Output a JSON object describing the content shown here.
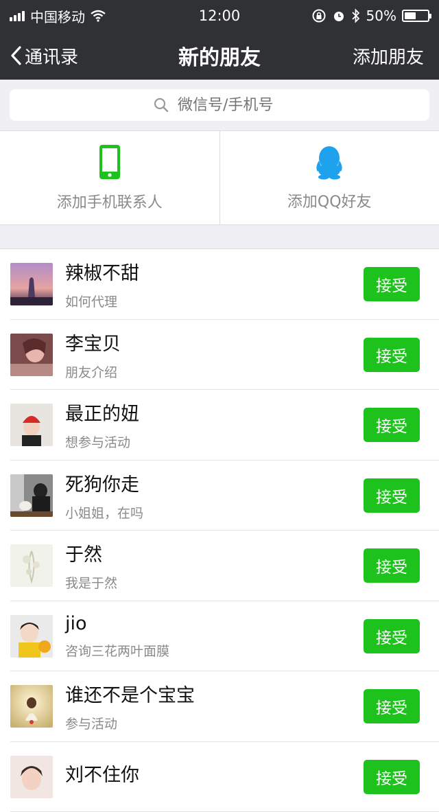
{
  "status_bar": {
    "carrier": "中国移动",
    "time": "12:00",
    "battery_percent": "50%",
    "battery_level": 0.5
  },
  "nav": {
    "back_label": "通讯录",
    "title": "新的朋友",
    "action_label": "添加朋友"
  },
  "search": {
    "placeholder": "微信号/手机号"
  },
  "add_options": [
    {
      "label": "添加手机联系人",
      "icon": "phone-icon",
      "color": "#1dc21c"
    },
    {
      "label": "添加QQ好友",
      "icon": "qq-icon",
      "color": "#1ea2ee"
    }
  ],
  "friends": [
    {
      "name": "辣椒不甜",
      "message": "如何代理",
      "button": "接受"
    },
    {
      "name": "李宝贝",
      "message": "朋友介绍",
      "button": "接受"
    },
    {
      "name": "最正的妞",
      "message": "想参与活动",
      "button": "接受"
    },
    {
      "name": "死狗你走",
      "message": "小姐姐，在吗",
      "button": "接受"
    },
    {
      "name": "于然",
      "message": "我是于然",
      "button": "接受"
    },
    {
      "name": "jio",
      "message": "咨询三花两叶面膜",
      "button": "接受"
    },
    {
      "name": "谁还不是个宝宝",
      "message": "参与活动",
      "button": "接受"
    },
    {
      "name": "刘不住你",
      "message": "",
      "button": "接受"
    }
  ],
  "colors": {
    "accent_green": "#1dc21c",
    "header_bg": "#2f3135",
    "qq_blue": "#1ea2ee"
  }
}
